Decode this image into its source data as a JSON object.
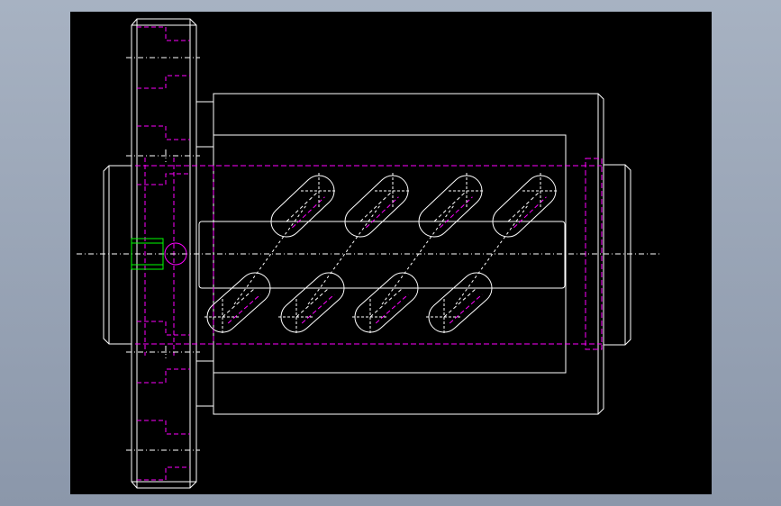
{
  "viewport": {
    "background_top": "#a7b2c2",
    "background_bottom": "#8b97aa"
  },
  "drawing": {
    "background": "#000000",
    "colors": {
      "outline": "#ffffff",
      "hidden": "#ff00ff",
      "centerline": "#ffffff",
      "highlight": "#00ff00"
    },
    "slot_count": 4,
    "bottom_slot_count": 4
  }
}
